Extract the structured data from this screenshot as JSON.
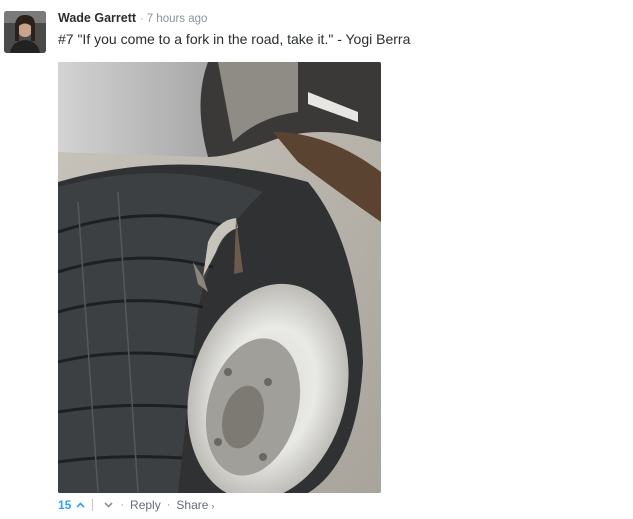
{
  "comment": {
    "author": "Wade Garrett",
    "time": "7 hours ago",
    "text": "#7 \"If you come to a fork in the road, take it.\" - Yogi Berra",
    "image_alt_icon": "photo-fork-in-tire",
    "votes": "15",
    "reply_label": "Reply",
    "share_label": "Share",
    "separator": "·",
    "share_chevron": "›"
  },
  "colors": {
    "vote_blue": "#2e9fff",
    "meta_gray": "#8a9399",
    "text_dark": "#2a2e2e"
  }
}
